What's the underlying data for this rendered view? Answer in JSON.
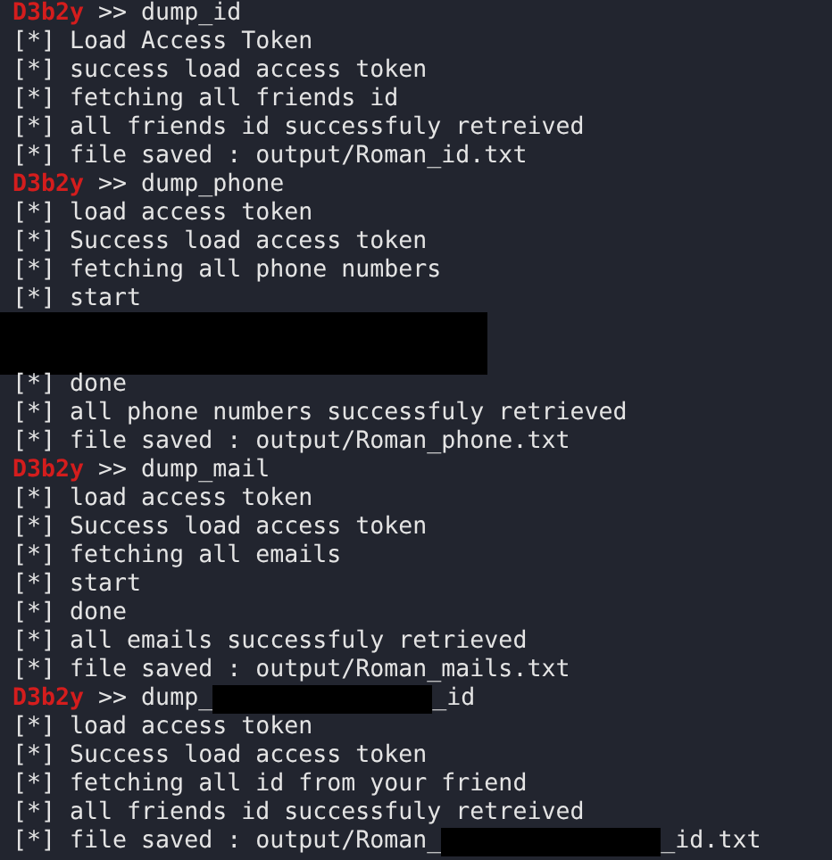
{
  "terminal": {
    "lines": [
      {
        "kind": "prompt",
        "user": "D3b2y",
        "parts": [
          {
            "text": ">> dump_id"
          }
        ]
      },
      {
        "kind": "output",
        "parts": [
          {
            "text": "[*] Load Access Token"
          }
        ]
      },
      {
        "kind": "output",
        "parts": [
          {
            "text": "[*] success load access token"
          }
        ]
      },
      {
        "kind": "output",
        "parts": [
          {
            "text": "[*] fetching all friends id"
          }
        ]
      },
      {
        "kind": "output",
        "parts": [
          {
            "text": "[*] all friends id successfuly retreived"
          }
        ]
      },
      {
        "kind": "output",
        "parts": [
          {
            "text": "[*] file saved : output/Roman_id.txt"
          }
        ]
      },
      {
        "kind": "prompt",
        "user": "D3b2y",
        "parts": [
          {
            "text": ">> dump_phone"
          }
        ]
      },
      {
        "kind": "output",
        "parts": [
          {
            "text": "[*] load access token"
          }
        ]
      },
      {
        "kind": "output",
        "parts": [
          {
            "text": "[*] Success load access token"
          }
        ]
      },
      {
        "kind": "output",
        "parts": [
          {
            "text": "[*] fetching all phone numbers"
          }
        ]
      },
      {
        "kind": "output",
        "parts": [
          {
            "text": "[*] start"
          }
        ]
      },
      {
        "kind": "redacted"
      },
      {
        "kind": "redacted"
      },
      {
        "kind": "output",
        "parts": [
          {
            "text": "[*] done"
          }
        ]
      },
      {
        "kind": "output",
        "parts": [
          {
            "text": "[*] all phone numbers successfuly retrieved"
          }
        ]
      },
      {
        "kind": "output",
        "parts": [
          {
            "text": "[*] file saved : output/Roman_phone.txt"
          }
        ]
      },
      {
        "kind": "prompt",
        "user": "D3b2y",
        "parts": [
          {
            "text": ">> dump_mail"
          }
        ]
      },
      {
        "kind": "output",
        "parts": [
          {
            "text": "[*] load access token"
          }
        ]
      },
      {
        "kind": "output",
        "parts": [
          {
            "text": "[*] Success load access token"
          }
        ]
      },
      {
        "kind": "output",
        "parts": [
          {
            "text": "[*] fetching all emails"
          }
        ]
      },
      {
        "kind": "output",
        "parts": [
          {
            "text": "[*] start"
          }
        ]
      },
      {
        "kind": "output",
        "parts": [
          {
            "text": "[*] done"
          }
        ]
      },
      {
        "kind": "output",
        "parts": [
          {
            "text": "[*] all emails successfuly retrieved"
          }
        ]
      },
      {
        "kind": "output",
        "parts": [
          {
            "text": "[*] file saved : output/Roman_mails.txt"
          }
        ]
      },
      {
        "kind": "prompt",
        "user": "D3b2y",
        "parts": [
          {
            "text": ">> dump_"
          },
          {
            "kind": "redacted"
          },
          {
            "text": "_id"
          }
        ]
      },
      {
        "kind": "output",
        "parts": [
          {
            "text": "[*] load access token"
          }
        ]
      },
      {
        "kind": "output",
        "parts": [
          {
            "text": "[*] Success load access token"
          }
        ]
      },
      {
        "kind": "output",
        "parts": [
          {
            "text": "[*] fetching all id from your friend"
          }
        ]
      },
      {
        "kind": "output",
        "parts": [
          {
            "text": "[*] all friends id successfuly retreived"
          }
        ]
      },
      {
        "kind": "output",
        "parts": [
          {
            "text": "[*] file saved : output/Roman_"
          },
          {
            "kind": "redacted"
          },
          {
            "text": "_id.txt"
          }
        ]
      }
    ]
  }
}
